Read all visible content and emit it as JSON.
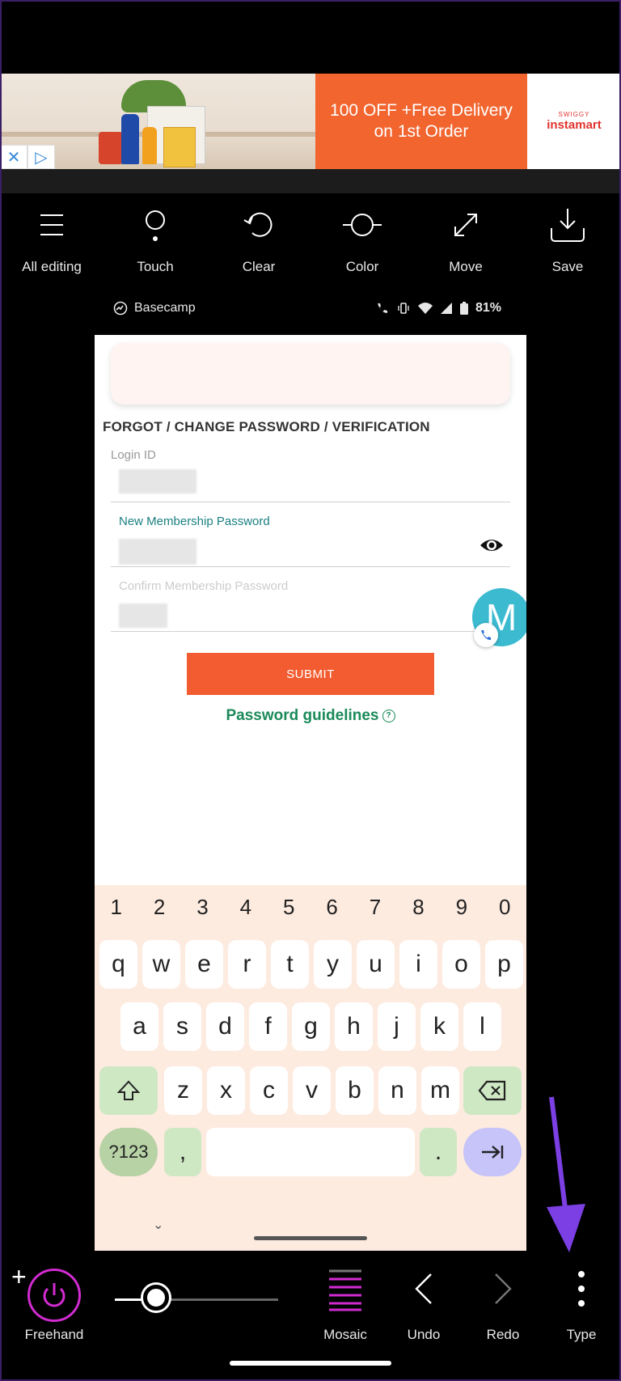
{
  "ad": {
    "offer_line1": "100 OFF +Free Delivery",
    "offer_line2": "on 1st Order",
    "brand_small": "SWIGGY",
    "brand_big": "instamart",
    "close_glyph": "✕",
    "adchoices_glyph": "▷"
  },
  "toolbar": {
    "items": [
      {
        "label": "All editing",
        "icon": "menu-icon"
      },
      {
        "label": "Touch",
        "icon": "touch-icon"
      },
      {
        "label": "Clear",
        "icon": "clear-icon"
      },
      {
        "label": "Color",
        "icon": "color-icon"
      },
      {
        "label": "Move",
        "icon": "move-icon"
      },
      {
        "label": "Save",
        "icon": "save-icon"
      }
    ]
  },
  "status_bar": {
    "app_name": "Basecamp",
    "battery": "81%"
  },
  "form": {
    "title": "FORGOT / CHANGE PASSWORD / VERIFICATION",
    "login_label": "Login ID",
    "new_password_label": "New Membership Password",
    "confirm_password_label": "Confirm Membership Password",
    "submit_label": "SUBMIT",
    "guidelines_label": "Password guidelines",
    "guidelines_icon": "?",
    "avatar_letter": "M"
  },
  "keyboard": {
    "numbers": [
      "1",
      "2",
      "3",
      "4",
      "5",
      "6",
      "7",
      "8",
      "9",
      "0"
    ],
    "row1": [
      "q",
      "w",
      "e",
      "r",
      "t",
      "y",
      "u",
      "i",
      "o",
      "p"
    ],
    "row2": [
      "a",
      "s",
      "d",
      "f",
      "g",
      "h",
      "j",
      "k",
      "l"
    ],
    "row3": [
      "z",
      "x",
      "c",
      "v",
      "b",
      "n",
      "m"
    ],
    "sym_label": "?123",
    "comma": ",",
    "period": ".",
    "collapse_glyph": "⌄"
  },
  "bottom_bar": {
    "plus": "+",
    "freehand": "Freehand",
    "mosaic": "Mosaic",
    "undo": "Undo",
    "redo": "Redo",
    "type": "Type",
    "brush_size_fraction": 0.25
  },
  "colors": {
    "accent_magenta": "#d12bd0",
    "submit_orange": "#f25c30",
    "guideline_green": "#1a8a5a",
    "annotation_arrow": "#7b3fe4"
  }
}
